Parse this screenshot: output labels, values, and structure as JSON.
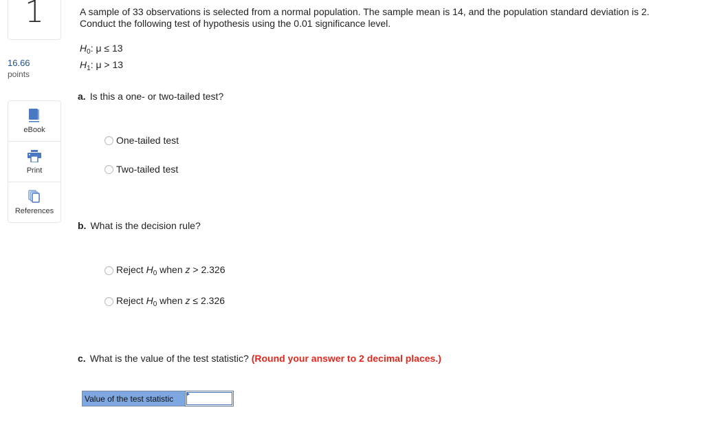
{
  "question": {
    "number": "1",
    "points_value": "16.66",
    "points_label": "points"
  },
  "tools": [
    {
      "label": "eBook",
      "icon": "book-icon"
    },
    {
      "label": "Print",
      "icon": "printer-icon"
    },
    {
      "label": "References",
      "icon": "documents-icon"
    }
  ],
  "prompt": {
    "line1": "A sample of 33 observations is selected from a normal population. The sample mean is 14, and the population standard deviation is 2.",
    "line2": "Conduct the following test of hypothesis using the 0.01 significance level."
  },
  "hypotheses": {
    "h0": {
      "symbol": "H",
      "sub": "0",
      "text": ": μ ≤ 13"
    },
    "h1": {
      "symbol": "H",
      "sub": "1",
      "text": ": μ > 13"
    }
  },
  "part_a": {
    "letter": "a.",
    "question": "Is this a one- or two-tailed test?",
    "options": [
      "One-tailed test",
      "Two-tailed test"
    ]
  },
  "part_b": {
    "letter": "b.",
    "question": "What is the decision rule?",
    "options": [
      {
        "prefix": "Reject ",
        "h": "H",
        "sub": "0",
        "mid": " when ",
        "z": "z",
        "rel": " > 2.326"
      },
      {
        "prefix": "Reject ",
        "h": "H",
        "sub": "0",
        "mid": " when ",
        "z": "z",
        "rel": " ≤ 2.326"
      }
    ]
  },
  "part_c": {
    "letter": "c.",
    "question": "What is the value of the test statistic?",
    "instruction": "(Round your answer to 2 decimal places.)",
    "answer_label": "Value of the test statistic",
    "answer_value": ""
  },
  "colors": {
    "points": "#1f4e8c",
    "instruction_red": "#e0281e",
    "answer_label_bg": "#7ea6e0",
    "icon_blue": "#4a78c2"
  }
}
